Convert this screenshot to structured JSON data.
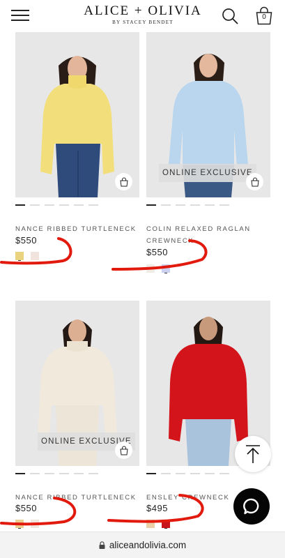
{
  "header": {
    "brand_name": "ALICE + OLIVIA",
    "brand_sub": "BY STACEY BENDET",
    "bag_count": "0"
  },
  "icons": {
    "menu": "hamburger-menu-icon",
    "search": "search-icon",
    "bag": "shopping-bag-icon",
    "quick_add": "bag-icon",
    "back_to_top": "arrow-up-icon",
    "chat": "chat-bubble-icon",
    "lock": "lock-icon"
  },
  "products": [
    {
      "name": "NANCE RIBBED TURTLENECK",
      "price": "$550",
      "badge": "",
      "image_color": "#f2de7a",
      "swatches": [
        "#e9d37e",
        "#f1e4de"
      ],
      "selected_swatch": 0
    },
    {
      "name": "COLIN RELAXED RAGLAN CREWNECK",
      "price": "$550",
      "badge": "ONLINE EXCLUSIVE",
      "image_color": "#b9d6ee",
      "swatches": [
        "#f0ece6",
        "#cdd0ee"
      ],
      "selected_swatch": 1
    },
    {
      "name": "NANCE RIBBED TURTLENECK",
      "price": "$550",
      "badge": "ONLINE EXCLUSIVE",
      "image_color": "#f1e9db",
      "swatches": [
        "#e9cf92",
        "#f1e4de"
      ],
      "selected_swatch": 0
    },
    {
      "name": "ENSLEY CREWNECK",
      "price": "$495",
      "badge": "",
      "image_color": "#d3141b",
      "swatches": [
        "#ead0a8",
        "#c8141b"
      ],
      "selected_swatch": 1
    }
  ],
  "carousel": {
    "dot_count": 6,
    "active_index": 0
  },
  "browser": {
    "url": "aliceandolivia.com"
  },
  "colors": {
    "annotation": "#e21a0e",
    "image_background": "#e7e7e7",
    "chat_button": "#050505"
  }
}
